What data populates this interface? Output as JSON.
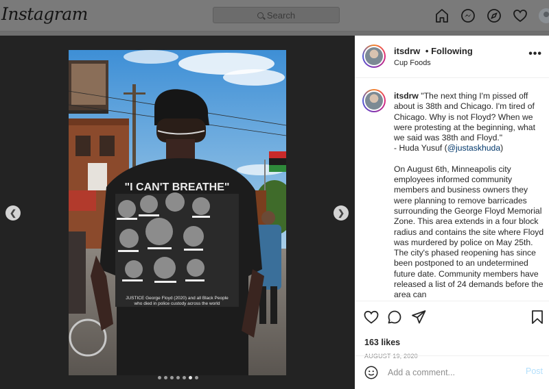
{
  "nav": {
    "logo": "Instagram",
    "search_placeholder": "Search",
    "icons": [
      "home-icon",
      "messenger-icon",
      "explore-icon",
      "activity-heart-icon",
      "profile-avatar"
    ]
  },
  "photo": {
    "shirt_headline": "\"I CAN'T BREATHE\"",
    "shirt_footer_1": "JUSTICE George Floyd (2020) and all Black People",
    "shirt_footer_2": "who died in police custody across the world",
    "carousel_total": 7,
    "carousel_active": 6
  },
  "post": {
    "username": "itsdrw",
    "separator": "•",
    "follow_status": "Following",
    "location": "Cup Foods",
    "more": "•••",
    "caption_user": "itsdrw",
    "caption_p1": "\"The next thing I'm pissed off about is 38th and Chicago. I'm tired of Chicago. Why is not Floyd? When we were protesting at the beginning, what we said was 38th and Floyd.\"",
    "caption_p1_attr": "- Huda Yusuf (",
    "caption_mention": "@justaskhuda",
    "caption_p1_close": ")",
    "caption_p2": "On August 6th, Minneapolis city employees informed community members and business owners they were planning to remove barricades surrounding the George Floyd Memorial Zone. This area extends in a four block radius and contains the site where Floyd was murdered by police on May 25th.  The city's phased reopening has since been postponed to an undetermined future date. Community members have released a list of 24 demands before the area can",
    "likes": "163 likes",
    "date": "AUGUST 19, 2020",
    "comment_placeholder": "Add a comment...",
    "post_button": "Post"
  },
  "colors": {
    "mention": "#00376b",
    "post_button_disabled": "#b2dffc",
    "overlay": "#6f6f6f"
  }
}
